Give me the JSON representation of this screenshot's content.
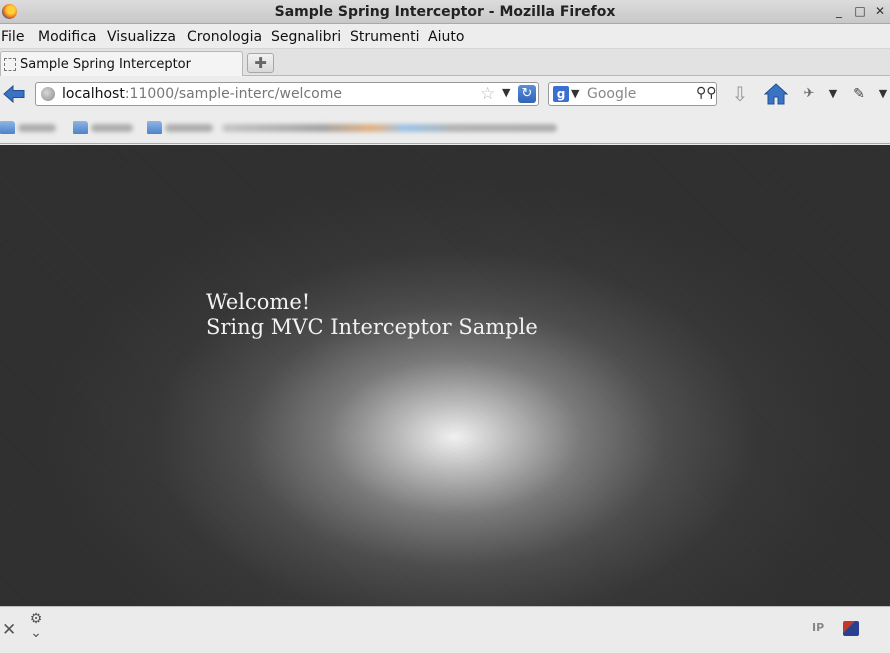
{
  "window": {
    "title": "Sample Spring Interceptor - Mozilla Firefox"
  },
  "menu": {
    "items": [
      {
        "label": "File"
      },
      {
        "label": "Modifica"
      },
      {
        "label": "Visualizza"
      },
      {
        "label": "Cronologia"
      },
      {
        "label": "Segnalibri"
      },
      {
        "label": "Strumenti"
      },
      {
        "label": "Aiuto"
      }
    ]
  },
  "tabs": [
    {
      "label": "Sample Spring Interceptor",
      "active": true
    }
  ],
  "navigation": {
    "url_host": "localhost",
    "url_path": ":11000/sample-interc/welcome",
    "search_placeholder": "Google",
    "search_engine_letter": "g"
  },
  "page": {
    "line1": "Welcome!",
    "line2": "Sring MVC Interceptor Sample"
  },
  "addon_bar": {
    "ip_label": "IP"
  },
  "colors": {
    "accent": "#2f63b7",
    "content_dark": "#2e2e2e",
    "content_glow": "#f4f4f4"
  }
}
